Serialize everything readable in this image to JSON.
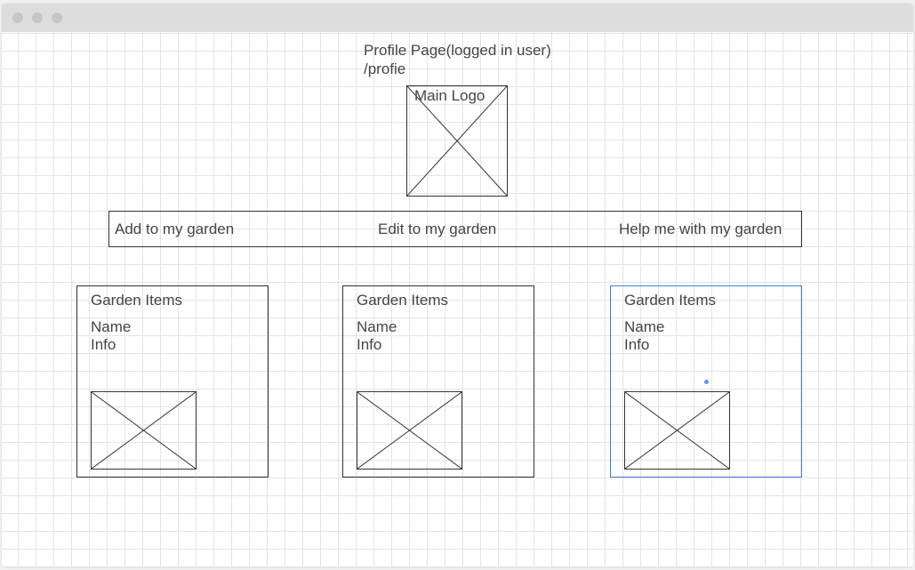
{
  "page": {
    "title": "Profile Page(logged in user)",
    "route": "/profie"
  },
  "logo": {
    "label": "Main Logo"
  },
  "nav": {
    "add": "Add to my garden",
    "edit": "Edit to my garden",
    "help": "Help me with my garden"
  },
  "cards": [
    {
      "title": "Garden Items",
      "name": "Name",
      "info": "Info"
    },
    {
      "title": "Garden Items",
      "name": "Name",
      "info": "Info"
    },
    {
      "title": "Garden Items",
      "name": "Name",
      "info": "Info"
    }
  ],
  "colors": {
    "stroke": "#333333",
    "selection": "#4a7bd1"
  }
}
